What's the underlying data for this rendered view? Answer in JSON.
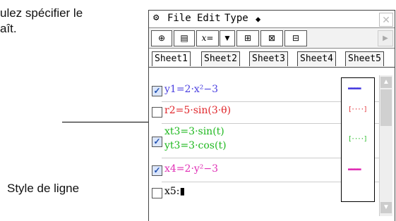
{
  "doc": {
    "text": "ulez spécifier le\naît.",
    "callout_label": "Style de ligne"
  },
  "window": {
    "menu": {
      "gear_glyph": "⚙",
      "file": "File",
      "edit": "Edit",
      "type": "Type",
      "diamond": "◆",
      "close": "✕"
    },
    "toolbar": [
      {
        "name": "graph-icon",
        "glyph": "⊕"
      },
      {
        "name": "table-icon",
        "glyph": "▤"
      },
      {
        "name": "define-x-icon",
        "glyph": "x="
      },
      {
        "name": "dropdown-arrow-icon",
        "glyph": "▼"
      },
      {
        "name": "zoom-box-icon",
        "glyph": "⊞"
      },
      {
        "name": "zoom-auto-icon",
        "glyph": "⊠"
      },
      {
        "name": "split-icon",
        "glyph": "⊟"
      }
    ],
    "toolbar_right": "▶",
    "tabs": [
      "Sheet1",
      "Sheet2",
      "Sheet3",
      "Sheet4",
      "Sheet5"
    ],
    "active_tab": "Sheet1",
    "functions": [
      {
        "checked": true,
        "label": "y1=2·x²−3",
        "color": "#4a3fe0",
        "line_style": "solid"
      },
      {
        "checked": false,
        "label": "r2=5·sin(3·θ)",
        "color": "#e0262b",
        "line_style": "dotted"
      },
      {
        "checked": true,
        "label": "xt3=3·sin(t)",
        "label2": "yt3=3·cos(t)",
        "color": "#1eb81e",
        "line_style": "dotted"
      },
      {
        "checked": true,
        "label": "x4=2·y²−3",
        "color": "#e02fb5",
        "line_style": "solid"
      },
      {
        "checked": false,
        "label": "x5:▮",
        "color": "#000000",
        "line_style": "none"
      }
    ],
    "line_styles": [
      "▬▬▬▬",
      "[····]",
      "[····]",
      "▬▬▬▬"
    ],
    "check_glyph": "✓",
    "scroll": {
      "up": "▲",
      "down": "▼"
    }
  }
}
